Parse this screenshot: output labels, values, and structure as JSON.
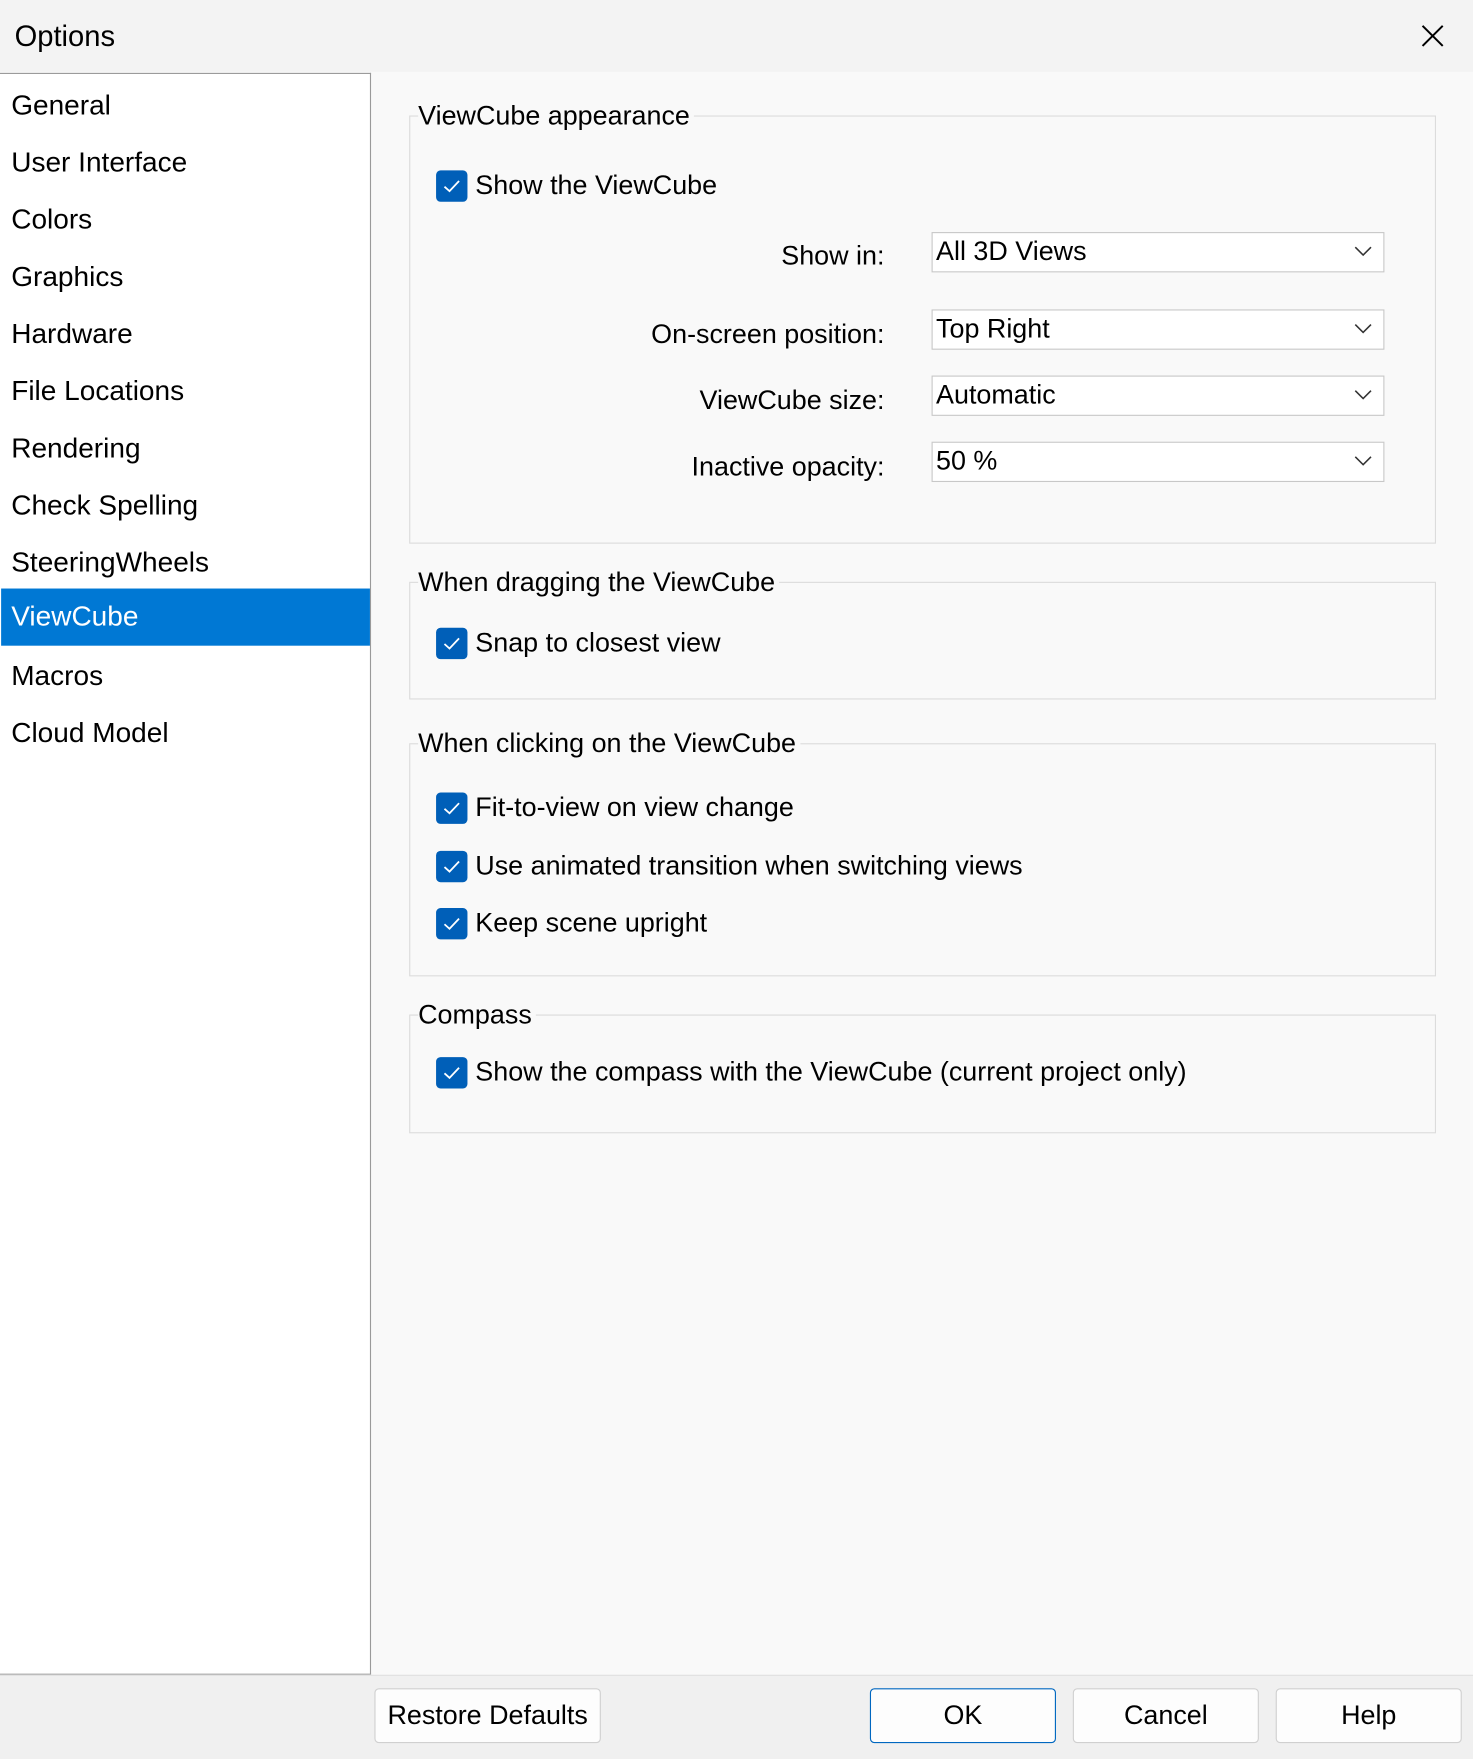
{
  "window": {
    "title": "Options",
    "close_icon": "close-icon"
  },
  "sidebar": {
    "items": [
      {
        "label": "General"
      },
      {
        "label": "User Interface"
      },
      {
        "label": "Colors"
      },
      {
        "label": "Graphics"
      },
      {
        "label": "Hardware"
      },
      {
        "label": "File Locations"
      },
      {
        "label": "Rendering"
      },
      {
        "label": "Check Spelling"
      },
      {
        "label": "SteeringWheels"
      },
      {
        "label": "ViewCube",
        "selected": true
      },
      {
        "label": "Macros"
      },
      {
        "label": "Cloud Model"
      }
    ]
  },
  "appearance": {
    "legend": "ViewCube appearance",
    "show_viewcube": {
      "label": "Show the ViewCube",
      "checked": true
    },
    "show_in": {
      "label": "Show in:",
      "value": "All 3D Views"
    },
    "position": {
      "label": "On-screen position:",
      "value": "Top Right"
    },
    "size": {
      "label": "ViewCube size:",
      "value": "Automatic"
    },
    "opacity": {
      "label": "Inactive opacity:",
      "value": "50 %"
    }
  },
  "dragging": {
    "legend": "When dragging the ViewCube",
    "snap": {
      "label": "Snap to closest view",
      "checked": true
    }
  },
  "clicking": {
    "legend": "When clicking on the ViewCube",
    "fit": {
      "label": "Fit-to-view on view change",
      "checked": true
    },
    "animated": {
      "label": "Use animated transition when switching views",
      "checked": true
    },
    "upright": {
      "label": "Keep scene upright",
      "checked": true
    }
  },
  "compass": {
    "legend": "Compass",
    "show": {
      "label": "Show the compass with the ViewCube (current project only)",
      "checked": true
    }
  },
  "footer": {
    "restore": "Restore Defaults",
    "ok": "OK",
    "cancel": "Cancel",
    "help": "Help"
  },
  "colors": {
    "accent": "#0078d4",
    "checkbox": "#005fb8"
  }
}
